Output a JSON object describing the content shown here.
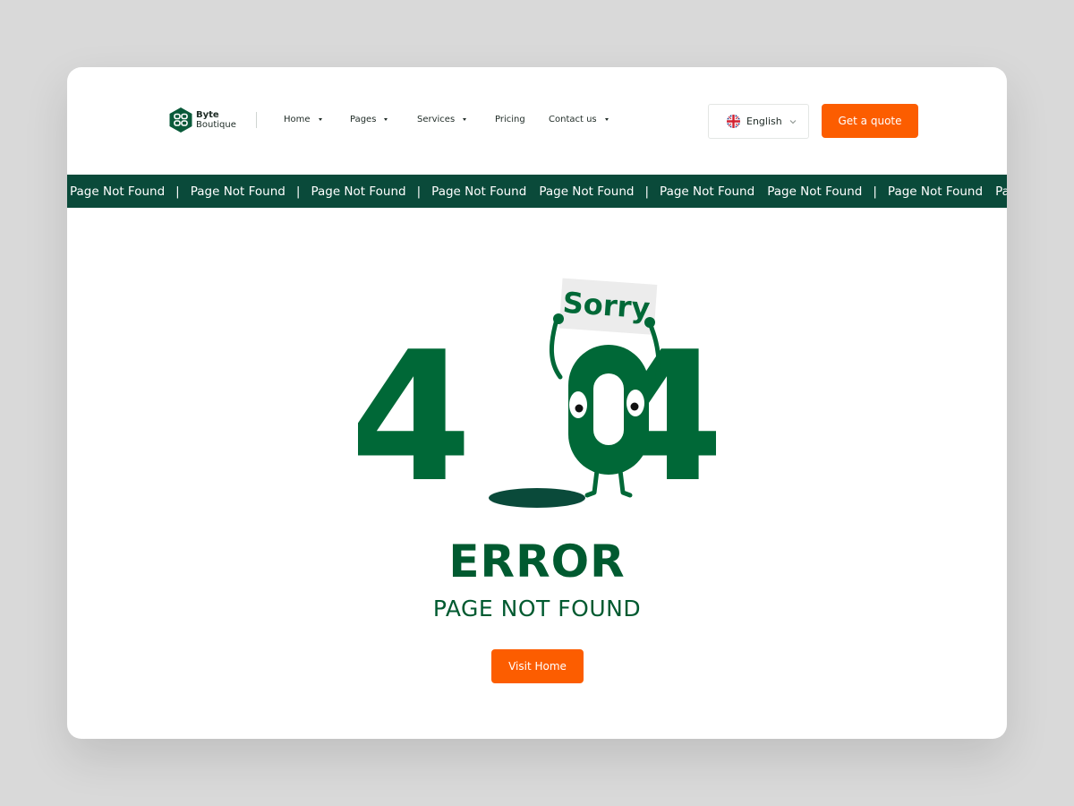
{
  "brand": {
    "name_line1": "Byte",
    "name_line2": "Boutique"
  },
  "nav": {
    "items": [
      {
        "label": "Home",
        "has_dropdown": true
      },
      {
        "label": "Pages",
        "has_dropdown": true
      },
      {
        "label": "Services",
        "has_dropdown": true
      },
      {
        "label": "Pricing",
        "has_dropdown": false
      },
      {
        "label": "Contact us",
        "has_dropdown": true
      }
    ]
  },
  "language": {
    "selected": "English",
    "icon": "uk-flag-icon"
  },
  "header": {
    "cta_label": "Get a quote"
  },
  "marquee": {
    "items": [
      "Page Not Found",
      "Page Not Found",
      "Page Not Found",
      "Page Not Found",
      "Page Not Found",
      "Page Not Found",
      "Page Not Found",
      "Page Not Found",
      "Page Not Found"
    ],
    "separator": "|"
  },
  "illustration": {
    "sign_text": "Sorry",
    "digit_left": "4",
    "digit_right": "4"
  },
  "error": {
    "title": "ERROR",
    "subtitle": "PAGE NOT FOUND",
    "button_label": "Visit Home"
  },
  "colors": {
    "page_bg": "#d9d9d9",
    "brand_green": "#005a30",
    "band_green": "#0a4a3a",
    "accent_orange": "#fc5d00"
  }
}
